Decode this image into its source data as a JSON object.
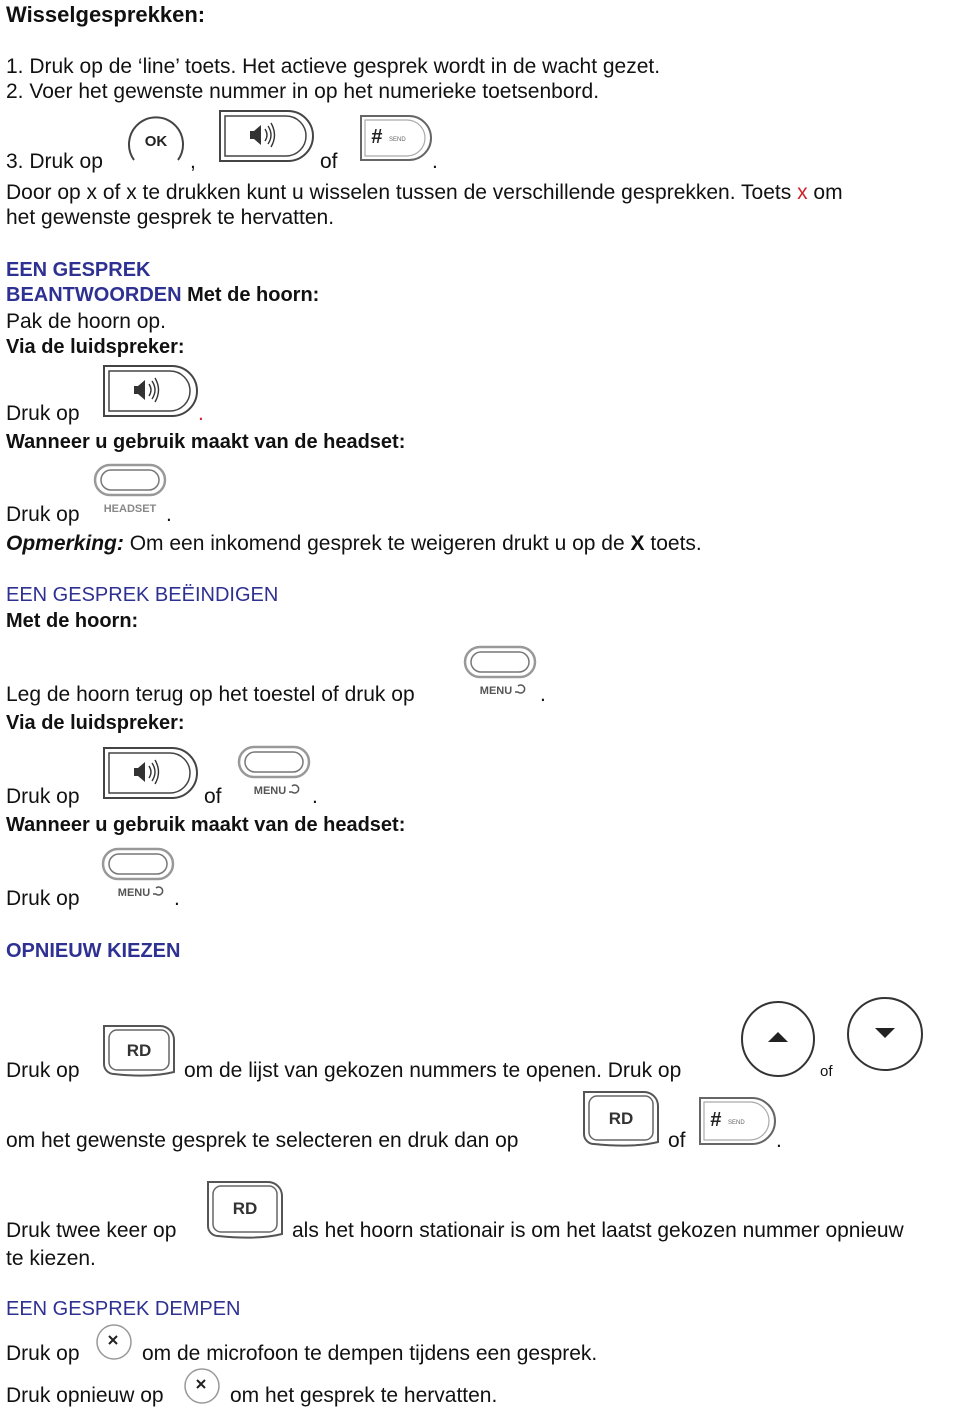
{
  "title": "Wisselgesprekken:",
  "steps": {
    "s1": "1. Druk op de ‘line’ toets. Het actieve gesprek wordt in de wacht gezet.",
    "s2": "2. Voer het gewenste nummer in op het numerieke toetsenbord.",
    "s3_prefix": "3. Druk op",
    "comma": ",",
    "of": "of",
    "period": ".",
    "switch_line1_a": "Door op x of x te drukken kunt u wisselen tussen de verschillende gesprekken. Toets",
    "switch_x": "x",
    "switch_line1_b": "om",
    "switch_line2": "het gewenste gesprek te hervatten."
  },
  "answer": {
    "heading_line1": "EEN GESPREK",
    "heading_line2": "BEANTWOORDEN",
    "handset_label": "Met de hoorn:",
    "handset_text": "Pak de hoorn op.",
    "speaker_label": "Via de luidspreker:",
    "speaker_text": "Druk op",
    "headset_label": "Wanneer u gebruik maakt van de headset:",
    "headset_text": "Druk op",
    "note_label": "Opmerking:",
    "note_text_a": "Om een inkomend gesprek te weigeren drukt u op de",
    "note_x": "X",
    "note_text_b": "toets."
  },
  "end": {
    "heading": "EEN GESPREK BEËINDIGEN",
    "handset_label": "Met de hoorn:",
    "handset_text": "Leg de hoorn terug op het toestel of druk op",
    "speaker_label": "Via de luidspreker:",
    "speaker_text": "Druk op",
    "headset_label": "Wanneer u gebruik maakt van de headset:",
    "headset_text": "Druk op"
  },
  "redial": {
    "heading": "OPNIEUW KIEZEN",
    "line1_a": "Druk op",
    "line1_b": "om de lijst van gekozen nummers te openen. Druk op",
    "line1_of": "of",
    "line2_a": "om het gewenste gesprek te selecteren en druk dan op",
    "line3_a": "Druk twee keer op",
    "line3_b": "als het hoorn stationair is om het laatst gekozen nummer opnieuw",
    "line3_c": "te kiezen."
  },
  "mute": {
    "heading": "EEN GESPREK DEMPEN",
    "line1_a": "Druk op",
    "line1_b": "om de microfoon te dempen tijdens een gesprek.",
    "line2_a": "Druk opnieuw op",
    "line2_b": "om het gesprek te hervatten."
  },
  "keys": {
    "ok": "OK",
    "headset": "HEADSET",
    "menu": "MENU",
    "rd": "RD",
    "send": "SEND",
    "hash": "#"
  },
  "colors": {
    "heading": "#2e3192",
    "accent_red": "#d0202a"
  }
}
